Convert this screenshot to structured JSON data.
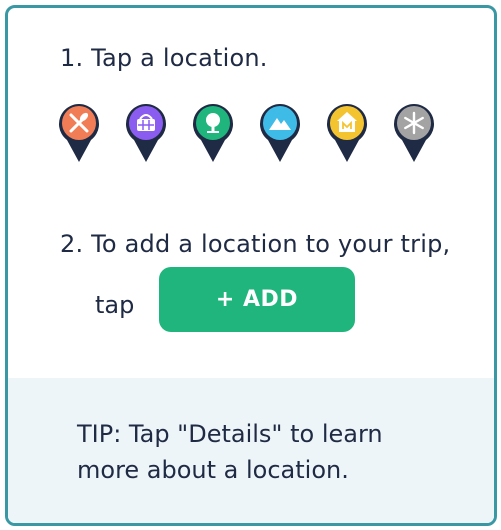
{
  "instructions": {
    "step1": "1. Tap a location.",
    "step2": "2. To add a location to your trip,",
    "tap_label": "tap",
    "add_button_label": "+ ADD",
    "tip": "TIP: Tap \"Details\" to learn more about a location."
  },
  "pins": [
    {
      "name": "restaurant",
      "icon": "fork-knife-icon",
      "color": "#f07d55"
    },
    {
      "name": "shopping",
      "icon": "basket-icon",
      "color": "#8a5df0"
    },
    {
      "name": "park",
      "icon": "tree-icon",
      "color": "#1fb57d"
    },
    {
      "name": "nature",
      "icon": "mountain-icon",
      "color": "#3fbbe8"
    },
    {
      "name": "museum",
      "icon": "museum-icon",
      "color": "#f4c430"
    },
    {
      "name": "winter",
      "icon": "snowflake-icon",
      "color": "#a3a3a3"
    }
  ],
  "colors": {
    "border": "#3a97a4",
    "pin_outline": "#1f2a44",
    "add_button": "#1fb57d",
    "tip_background": "#eef5f8",
    "text": "#1f2a44"
  }
}
